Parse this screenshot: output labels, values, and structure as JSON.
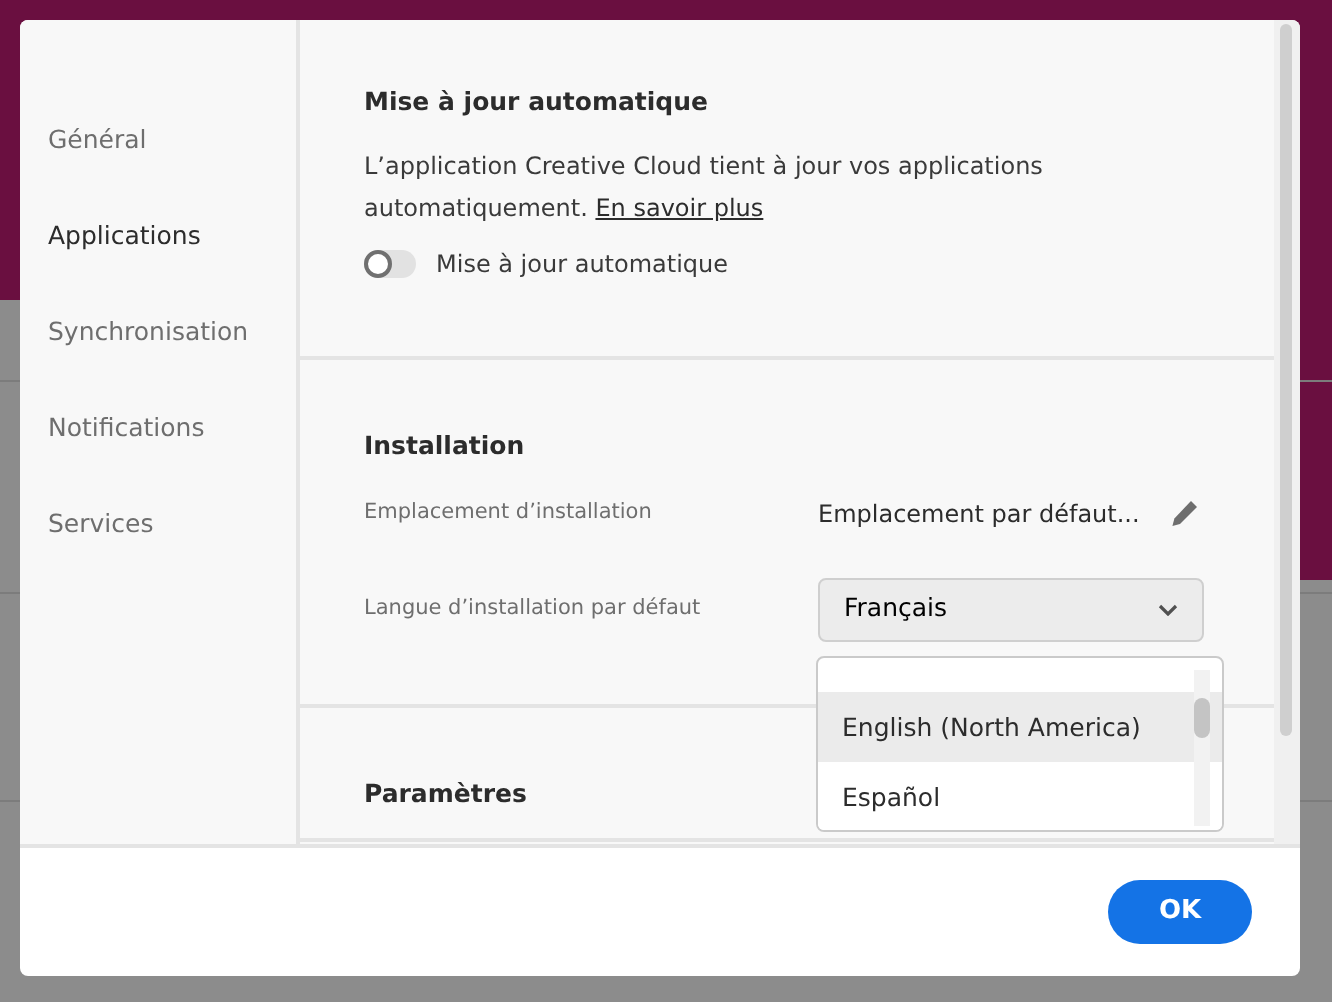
{
  "sidebar": {
    "items": [
      {
        "label": "Général",
        "selected": false
      },
      {
        "label": "Applications",
        "selected": true
      },
      {
        "label": "Synchronisation",
        "selected": false
      },
      {
        "label": "Notifications",
        "selected": false
      },
      {
        "label": "Services",
        "selected": false
      }
    ]
  },
  "sections": [
    {
      "title": "Mise à jour automatique",
      "description": "L’application Creative Cloud tient à jour vos applications automatiquement.",
      "link": "En savoir plus",
      "toggle": {
        "label": "Mise à jour automatique",
        "on": false
      }
    },
    {
      "title": "Installation",
      "rows": [
        {
          "kind": "value",
          "label": "Emplacement d’installation",
          "value": "Emplacement par défaut..."
        },
        {
          "kind": "select",
          "label": "Langue d’installation par défaut",
          "value": "Français",
          "expanded": true,
          "options": [
            {
              "label": "English (North America)",
              "highlighted": true
            },
            {
              "label": "Español",
              "highlighted": false
            }
          ]
        }
      ]
    },
    {
      "title": "Paramètres"
    }
  ],
  "footer": {
    "buttons": [
      "OK"
    ]
  }
}
